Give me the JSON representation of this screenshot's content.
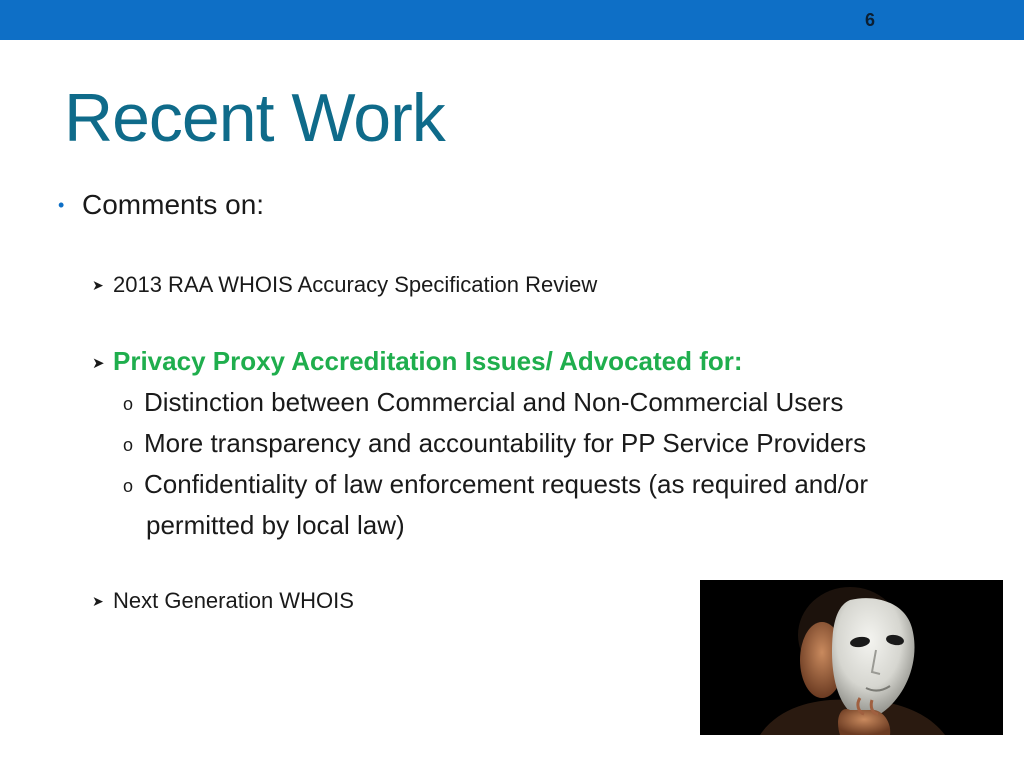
{
  "slide": {
    "page_number": "6",
    "title": "Recent Work",
    "intro": "Comments on:",
    "items": [
      {
        "text": "2013 RAA WHOIS Accuracy Specification Review"
      },
      {
        "text": "Privacy Proxy Accreditation Issues/ Advocated for:"
      },
      {
        "text": "Next Generation WHOIS"
      }
    ],
    "subitems": [
      "Distinction between Commercial and Non-Commercial Users",
      "More transparency and accountability for PP Service Providers",
      "Confidentiality of law enforcement requests (as required and/or",
      "permitted by local law)"
    ],
    "photo": {
      "icon": "mask-photo-icon"
    },
    "colors": {
      "top_bar": "#0e6fc6",
      "title": "#0f6b8a",
      "highlight": "#1fae4d",
      "bullet": "#0e6fc6"
    }
  }
}
